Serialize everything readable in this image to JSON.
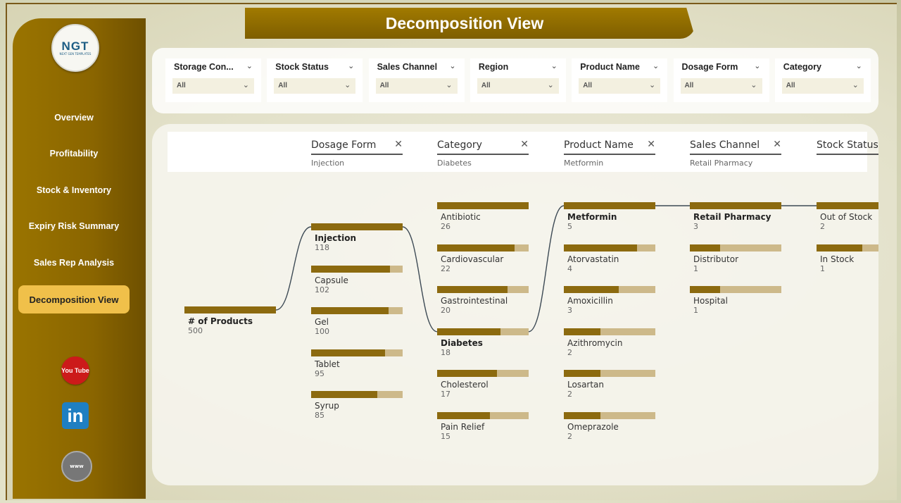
{
  "title": "Decomposition View",
  "logo": {
    "text": "NGT",
    "subtext": "NEXT GEN TEMPLATES"
  },
  "nav": [
    {
      "label": "Overview",
      "active": false
    },
    {
      "label": "Profitability",
      "active": false
    },
    {
      "label": "Stock & Inventory",
      "active": false
    },
    {
      "label": "Expiry Risk Summary",
      "active": false
    },
    {
      "label": "Sales Rep Analysis",
      "active": false
    },
    {
      "label": "Decomposition View",
      "active": true
    }
  ],
  "social": {
    "youtube": "You Tube",
    "linkedin": "in",
    "web": "www"
  },
  "filters": [
    {
      "label": "Storage Con...",
      "value": "All"
    },
    {
      "label": "Stock Status",
      "value": "All"
    },
    {
      "label": "Sales Channel",
      "value": "All"
    },
    {
      "label": "Region",
      "value": "All"
    },
    {
      "label": "Product Name",
      "value": "All"
    },
    {
      "label": "Dosage Form",
      "value": "All"
    },
    {
      "label": "Category",
      "value": "All"
    }
  ],
  "tree": {
    "levels": [
      {
        "name": "Dosage Form",
        "selected": "Injection"
      },
      {
        "name": "Category",
        "selected": "Diabetes"
      },
      {
        "name": "Product Name",
        "selected": "Metformin"
      },
      {
        "name": "Sales Channel",
        "selected": "Retail Pharmacy"
      },
      {
        "name": "Stock Status",
        "selected": ""
      }
    ],
    "root": {
      "label": "# of Products",
      "value": 500
    },
    "columns": [
      [
        {
          "label": "Injection",
          "value": 118,
          "bold": true
        },
        {
          "label": "Capsule",
          "value": 102
        },
        {
          "label": "Gel",
          "value": 100
        },
        {
          "label": "Tablet",
          "value": 95
        },
        {
          "label": "Syrup",
          "value": 85
        }
      ],
      [
        {
          "label": "Antibiotic",
          "value": 26
        },
        {
          "label": "Cardiovascular",
          "value": 22
        },
        {
          "label": "Gastrointestinal",
          "value": 20
        },
        {
          "label": "Diabetes",
          "value": 18,
          "bold": true
        },
        {
          "label": "Cholesterol",
          "value": 17
        },
        {
          "label": "Pain Relief",
          "value": 15
        }
      ],
      [
        {
          "label": "Metformin",
          "value": 5,
          "bold": true
        },
        {
          "label": "Atorvastatin",
          "value": 4
        },
        {
          "label": "Amoxicillin",
          "value": 3
        },
        {
          "label": "Azithromycin",
          "value": 2
        },
        {
          "label": "Losartan",
          "value": 2
        },
        {
          "label": "Omeprazole",
          "value": 2
        }
      ],
      [
        {
          "label": "Retail Pharmacy",
          "value": 3,
          "bold": true
        },
        {
          "label": "Distributor",
          "value": 1
        },
        {
          "label": "Hospital",
          "value": 1
        }
      ],
      [
        {
          "label": "Out of Stock",
          "value": 2
        },
        {
          "label": "In Stock",
          "value": 1
        }
      ]
    ]
  },
  "colors": {
    "bar": "#8c6a0f",
    "bar_bg": "#cdb98a",
    "accent": "#f0c04a"
  }
}
